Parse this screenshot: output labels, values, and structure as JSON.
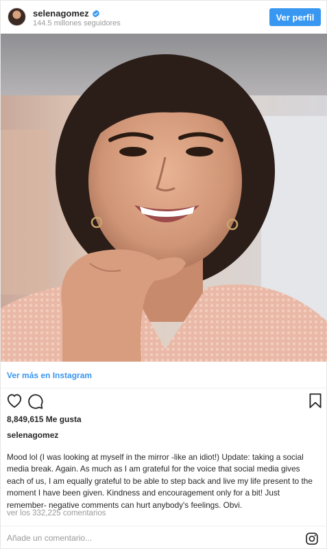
{
  "header": {
    "username": "selenagomez",
    "followers": "144.5 millones seguidores",
    "profile_button": "Ver perfil",
    "verified_icon": "verified-badge-icon"
  },
  "post": {
    "image_alt": "selenagomez"
  },
  "view_more_link": "Ver más en Instagram",
  "actions": {
    "like_icon": "heart-icon",
    "comment_icon": "comment-icon",
    "save_icon": "bookmark-icon"
  },
  "likes": "8,849,615 Me gusta",
  "caption": {
    "username": "selenagomez",
    "text": "Mood lol (I was looking at myself in the mirror -like an idiot!) Update: taking a social media break. Again. As much as I am grateful for the voice that social media gives each of us, I am equally grateful to be able to step back and live my life present to the moment I have been given. Kindness and encouragement only for a bit! Just remember- negative comments can hurt anybody's feelings. Obvi."
  },
  "comments_link": "ver los 332,225 comentarios",
  "comment_box": {
    "placeholder": "Añade un comentario..."
  },
  "colors": {
    "accent": "#3897f0",
    "text": "#262626",
    "muted": "#999999"
  }
}
